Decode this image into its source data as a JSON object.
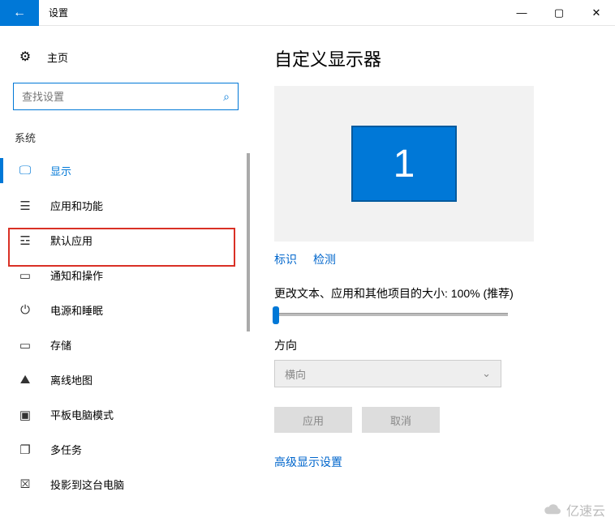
{
  "titlebar": {
    "title": "设置"
  },
  "sidebar": {
    "home": "主页",
    "search_placeholder": "查找设置",
    "category": "系统",
    "items": [
      {
        "label": "显示"
      },
      {
        "label": "应用和功能"
      },
      {
        "label": "默认应用"
      },
      {
        "label": "通知和操作"
      },
      {
        "label": "电源和睡眠"
      },
      {
        "label": "存储"
      },
      {
        "label": "离线地图"
      },
      {
        "label": "平板电脑模式"
      },
      {
        "label": "多任务"
      },
      {
        "label": "投影到这台电脑"
      }
    ]
  },
  "main": {
    "heading": "自定义显示器",
    "monitor_number": "1",
    "links": {
      "identify": "标识",
      "detect": "检测"
    },
    "scale_label": "更改文本、应用和其他项目的大小: 100% (推荐)",
    "orientation_label": "方向",
    "orientation_value": "横向",
    "buttons": {
      "apply": "应用",
      "cancel": "取消"
    },
    "advanced_link": "高级显示设置"
  },
  "watermark": "亿速云"
}
